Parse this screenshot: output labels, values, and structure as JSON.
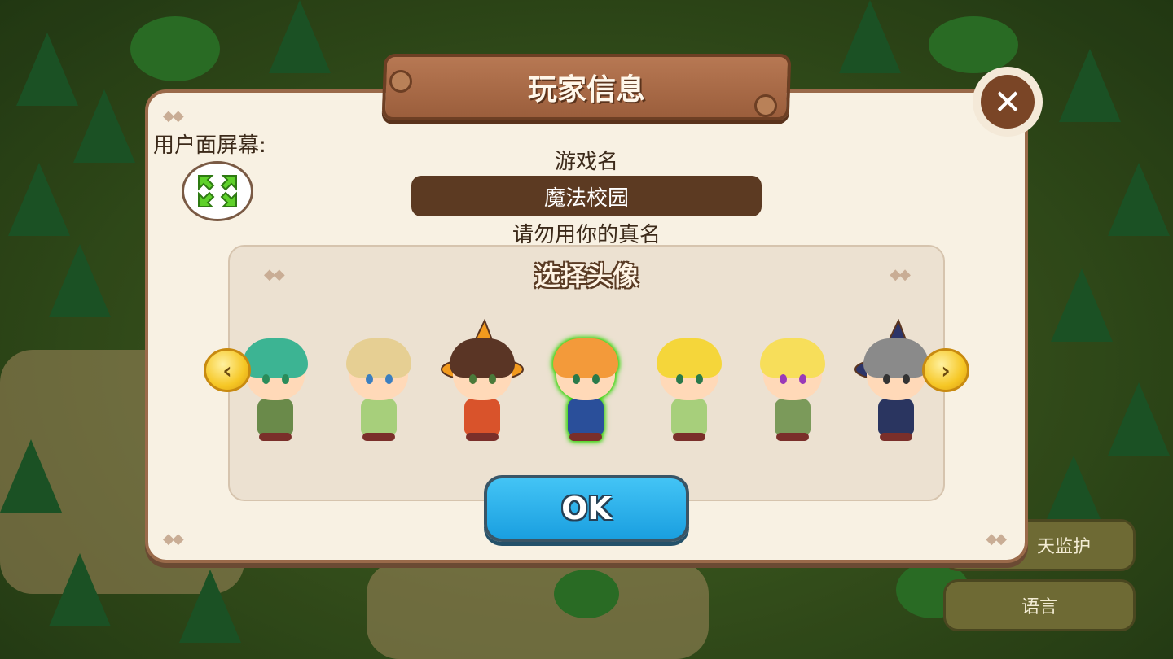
{
  "dialog": {
    "title": "玩家信息",
    "close_symbol": "✕",
    "screen_label": "用户面屏幕:",
    "game_name_label": "游戏名",
    "game_name_value": "魔法校园",
    "name_hint": "请勿用你的真名",
    "avatar_section_title": "选择头像",
    "ok_label": "OK"
  },
  "avatars": [
    {
      "name": "green-hair-elf-girl",
      "hair": "#3cb493",
      "body": "#6a8a4a",
      "skin": "#ffd9b8",
      "eye": "#2a8c5a"
    },
    {
      "name": "blond-boy",
      "hair": "#e6cf93",
      "body": "#a7cf7b",
      "skin": "#ffd9b8",
      "eye": "#3b7fbf"
    },
    {
      "name": "witch-girl",
      "hair": "#5a3525",
      "body": "#d9532b",
      "skin": "#ffd9b8",
      "eye": "#4a7a3a",
      "hat": "#f29a1e"
    },
    {
      "name": "orange-hair-schoolgirl",
      "hair": "#f39a3a",
      "body": "#2a4f9a",
      "skin": "#ffd9b8",
      "eye": "#2a7a4a",
      "selected": true
    },
    {
      "name": "blond-elf-boy",
      "hair": "#f5d63a",
      "body": "#a7cf7b",
      "skin": "#ffd9b8",
      "eye": "#2a7a4a"
    },
    {
      "name": "blond-elf-girl",
      "hair": "#f7de5a",
      "body": "#7b9a5a",
      "skin": "#ffd9b8",
      "eye": "#9a3ab8"
    },
    {
      "name": "old-wizard",
      "hair": "#8a8a8a",
      "body": "#2a3560",
      "skin": "#ffd9b8",
      "eye": "#333333",
      "hat": "#2c3468"
    }
  ],
  "side_buttons": {
    "monitor_label": "天监护",
    "language_label": "语言"
  },
  "colors": {
    "panel_bg": "#f8f1e3",
    "banner": "#a9694a",
    "name_field": "#5c3a22",
    "ok_button": "#1fa8e6",
    "arrow": "#f6c725",
    "selection_glow": "#2fd400"
  },
  "icons": {
    "fullscreen": "expand-arrows-icon",
    "prev": "chevron-left-icon",
    "next": "chevron-right-icon",
    "close": "close-icon"
  }
}
